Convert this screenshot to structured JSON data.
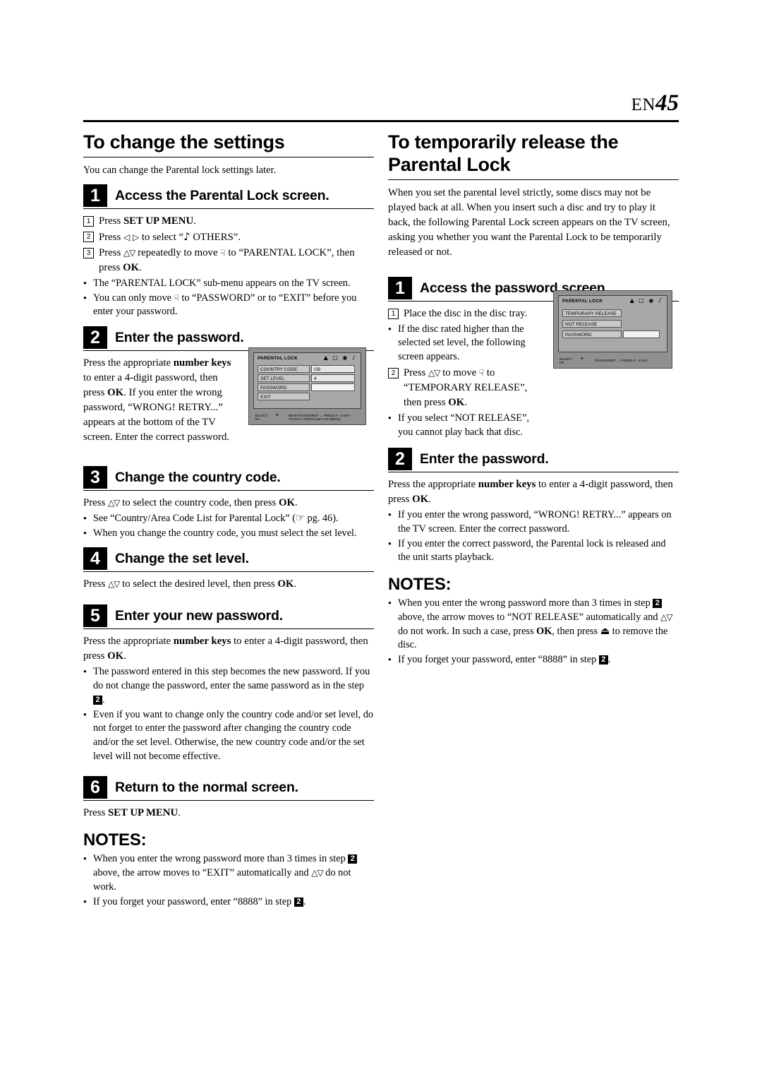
{
  "header": {
    "en_label": "EN",
    "page_number": "45"
  },
  "left": {
    "title": "To change the settings",
    "intro": "You can change the Parental lock settings later.",
    "step1": {
      "num": "1",
      "label": "Access the Parental Lock screen.",
      "items": [
        {
          "n": "1",
          "text_parts": [
            "Press ",
            "SET UP MENU",
            "."
          ]
        },
        {
          "n": "2",
          "text_parts": [
            "Press ",
            "◁ ▷",
            " to select “",
            "OTHERS”."
          ]
        },
        {
          "n": "3",
          "text_parts": [
            "Press ",
            "△▽",
            " repeatedly to move ",
            " to “PARENTAL LOCK”, then press ",
            "OK",
            "."
          ]
        }
      ],
      "item1": "Press SET UP MENU.",
      "item2": "Press ◁ ▷ to select “  OTHERS”.",
      "item3": "Press △▽ repeatedly to move  to “PARENTAL LOCK”, then press OK.",
      "bullets": [
        "The “PARENTAL LOCK” sub-menu appears on the TV screen.",
        "You can only move  to “PASSWORD” or to “EXIT” before you enter your password."
      ]
    },
    "step2": {
      "num": "2",
      "label": "Enter the password.",
      "body": "Press the appropriate number keys to enter a 4-digit password, then press OK. If you enter the wrong password, “WRONG! RETRY...” appears at the bottom of the TV screen. Enter the correct password."
    },
    "step3": {
      "num": "3",
      "label": "Change the country code.",
      "body": "Press △▽ to select the country code, then press OK.",
      "bullets": [
        "See “Country/Area Code List for Parental Lock” (☞ pg. 46).",
        "When you change the country code, you must select the set level."
      ]
    },
    "step4": {
      "num": "4",
      "label": "Change the set level.",
      "body": "Press △▽ to select the desired level, then press OK."
    },
    "step5": {
      "num": "5",
      "label": "Enter your new password.",
      "body": "Press the appropriate number keys to enter a 4-digit password, then press OK.",
      "bullets": [
        "The password entered in this step becomes the new password. If you do not change the password, enter the same password as in the step 2.",
        "Even if you want to change only the country code and/or set level, do not forget to enter the password after changing the country code and/or the set level. Otherwise, the new country code and/or the set level will not become effective."
      ]
    },
    "step6": {
      "num": "6",
      "label": "Return to the normal screen.",
      "body": "Press SET UP MENU."
    },
    "notes_title": "NOTES:",
    "notes": [
      "When you enter the wrong password more than 3 times in step 2 above, the arrow moves to “EXIT” automatically and △▽ do not work.",
      "If you forget your password, enter “8888” in step 2."
    ],
    "osd": {
      "title": "PARENTAL LOCK",
      "rows": [
        {
          "label": "COUNTRY CODE",
          "value": "GB"
        },
        {
          "label": "SET LEVEL",
          "value": "4"
        },
        {
          "label": "PASSWORD",
          "value": ""
        },
        {
          "label": "EXIT",
          "value": ""
        }
      ],
      "footer_left": "SELECT\nOK",
      "footer_right": "NEW PASSWORD? → PRESS 0 - 9 KEY\nTO EXIT, PRESS [SET UP MENU]"
    }
  },
  "right": {
    "title": "To temporarily release the Parental Lock",
    "intro": "When you set the parental level strictly, some discs may not be played back at all. When you insert such a disc and try to play it back, the following Parental Lock screen appears on the TV screen, asking you whether you want the Parental Lock to be temporarily released or not.",
    "step1": {
      "num": "1",
      "label": "Access the password screen.",
      "item1": "Place the disc in the disc tray.",
      "bullets1": [
        "If the disc rated higher than the selected set level, the following screen appears."
      ],
      "item2": "Press △▽ to move  to “TEMPORARY RELEASE”, then press OK.",
      "bullets2": [
        "If you select “NOT RELEASE”, you cannot play back that disc."
      ]
    },
    "step2": {
      "num": "2",
      "label": "Enter the password.",
      "body": "Press the appropriate number keys to enter a 4-digit password, then press OK.",
      "bullets": [
        "If you enter the wrong password, “WRONG! RETRY...” appears on the TV screen. Enter the correct password.",
        "If you enter the correct password, the Parental lock is released and the unit starts playback."
      ]
    },
    "notes_title": "NOTES:",
    "notes": [
      "When you enter the wrong password more than 3 times in step 2 above, the arrow moves to “NOT RELEASE” automatically and △▽ do not work. In such a case, press OK, then press ⏏ to remove the disc.",
      "If you forget your password, enter “8888” in step 2."
    ],
    "osd": {
      "title": "PARENTAL LOCK",
      "rows": [
        {
          "label": "TEMPORARY RELEASE",
          "value": ""
        },
        {
          "label": "NOT RELEASE",
          "value": ""
        },
        {
          "label": "PASSWORD",
          "value": ""
        }
      ],
      "footer_left": "SELECT\nOK",
      "footer_right": "PASSWORD? → PRESS 0 - 9 KEY"
    }
  }
}
